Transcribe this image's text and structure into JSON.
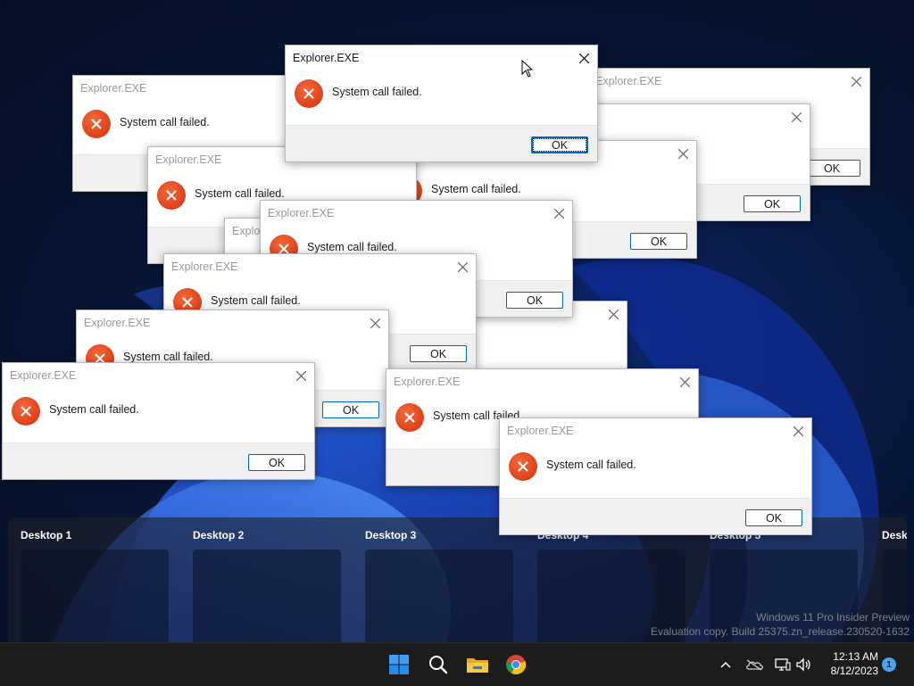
{
  "desktops": [
    {
      "label": "Desktop 1"
    },
    {
      "label": "Desktop 2"
    },
    {
      "label": "Desktop 3"
    },
    {
      "label": "Desktop 4"
    },
    {
      "label": "Desktop 5"
    },
    {
      "label": "Deskt"
    }
  ],
  "watermark": {
    "line1": "Windows 11 Pro Insider Preview",
    "line2": "Evaluation copy. Build 25375.zn_release.230520-1632"
  },
  "dialog": {
    "title": "Explorer.EXE",
    "message": "System call failed.",
    "ok_label": "OK",
    "partial_title": "Explor",
    "partial_title_2": "ExplorEXE"
  },
  "taskbar": {
    "apps": [
      {
        "name": "start-icon"
      },
      {
        "name": "search-icon"
      },
      {
        "name": "file-explorer-icon"
      },
      {
        "name": "chrome-icon"
      }
    ],
    "tray": [
      "chevron-up-icon",
      "onedrive-icon",
      "network-icon",
      "volume-icon"
    ],
    "time": "12:13 AM",
    "date": "8/12/2023",
    "notification_count": "1"
  },
  "colors": {
    "accent": "#0067c0",
    "error_icon": "#e2461e",
    "taskbar": "#1c1c1c"
  }
}
